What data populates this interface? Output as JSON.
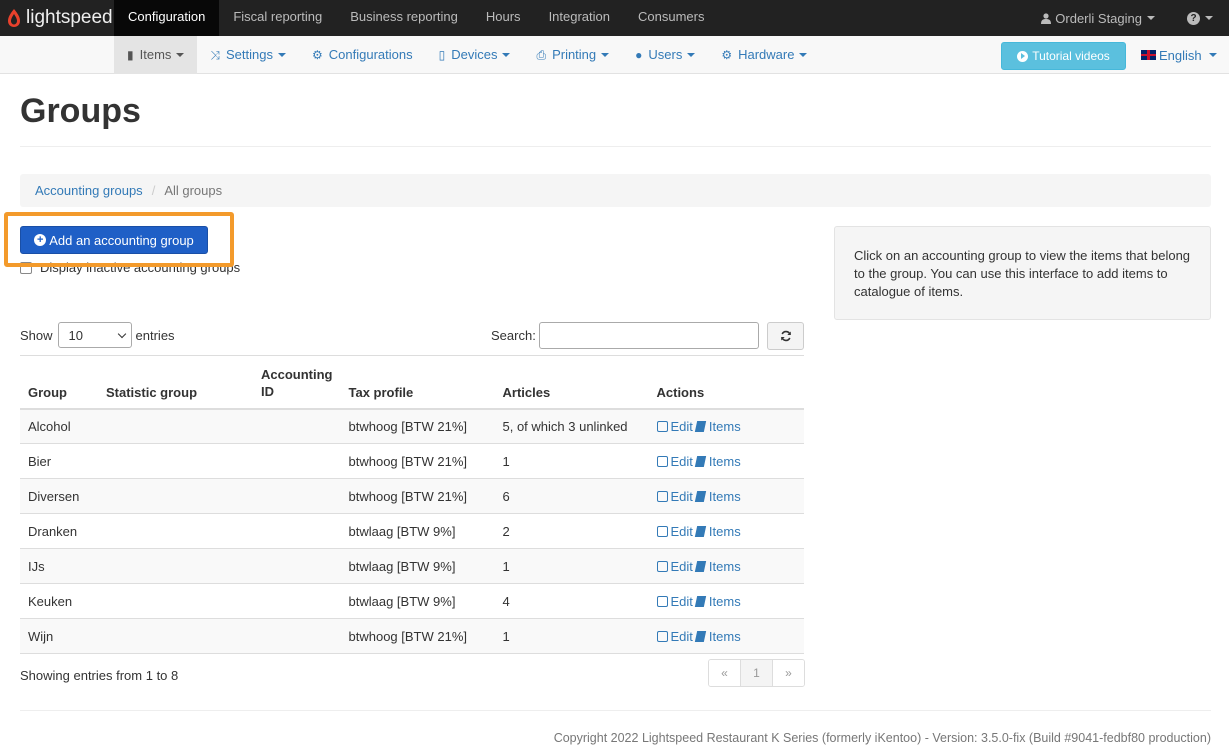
{
  "topbar": {
    "logo_text": "lightspeed",
    "nav": [
      "Configuration",
      "Fiscal reporting",
      "Business reporting",
      "Hours",
      "Integration",
      "Consumers"
    ],
    "active_index": 0,
    "user_label": "Orderli Staging",
    "help_label": "?"
  },
  "subnav": {
    "items": [
      {
        "label": "Items",
        "icon": "book-icon"
      },
      {
        "label": "Settings",
        "icon": "shuffle-icon"
      },
      {
        "label": "Configurations",
        "icon": "cog-icon"
      },
      {
        "label": "Devices",
        "icon": "tablet-icon"
      },
      {
        "label": "Printing",
        "icon": "printer-icon"
      },
      {
        "label": "Users",
        "icon": "user-icon"
      },
      {
        "label": "Hardware",
        "icon": "cog-icon"
      }
    ],
    "tutorial_label": "Tutorial videos",
    "language_label": "English"
  },
  "page": {
    "title": "Groups",
    "breadcrumb": {
      "link": "Accounting groups",
      "current": "All groups"
    },
    "add_button": "Add an accounting group",
    "inactive_checkbox_label": "Display inactive accounting groups",
    "show_label": "Show",
    "entries_label": "entries",
    "page_size": "10",
    "search_label": "Search:",
    "search_value": "",
    "info_text": "Click on an accounting group to view the items that belong to the group. You can use this interface to add items to catalogue of items.",
    "showing_text": "Showing entries from 1 to 8",
    "pager": {
      "prev": "«",
      "current": "1",
      "next": "»"
    },
    "footer": "Copyright 2022 Lightspeed Restaurant K Series (formerly iKentoo) - Version: 3.5.0-fix (Build #9041-fedbf80 production)"
  },
  "table": {
    "headers": [
      "Group",
      "Statistic group",
      "Accounting ID",
      "Tax profile",
      "Articles",
      "Actions"
    ],
    "edit_label": "Edit",
    "items_label": "Items",
    "rows": [
      {
        "group": "Alcohol",
        "statistic": "",
        "accounting_id": "",
        "tax": "btwhoog [BTW 21%]",
        "articles": "5, of which 3 unlinked"
      },
      {
        "group": "Bier",
        "statistic": "",
        "accounting_id": "",
        "tax": "btwhoog [BTW 21%]",
        "articles": "1"
      },
      {
        "group": "Diversen",
        "statistic": "",
        "accounting_id": "",
        "tax": "btwhoog [BTW 21%]",
        "articles": "6"
      },
      {
        "group": "Dranken",
        "statistic": "",
        "accounting_id": "",
        "tax": "btwlaag [BTW 9%]",
        "articles": "2"
      },
      {
        "group": "IJs",
        "statistic": "",
        "accounting_id": "",
        "tax": "btwlaag [BTW 9%]",
        "articles": "1"
      },
      {
        "group": "Keuken",
        "statistic": "",
        "accounting_id": "",
        "tax": "btwlaag [BTW 9%]",
        "articles": "4"
      },
      {
        "group": "Wijn",
        "statistic": "",
        "accounting_id": "",
        "tax": "btwhoog [BTW 21%]",
        "articles": "1"
      }
    ]
  },
  "colors": {
    "topbar": "#222222",
    "primary": "#1f5fc6",
    "info_button": "#5bc0de",
    "link": "#337ab7",
    "highlight": "#f39a2b"
  }
}
